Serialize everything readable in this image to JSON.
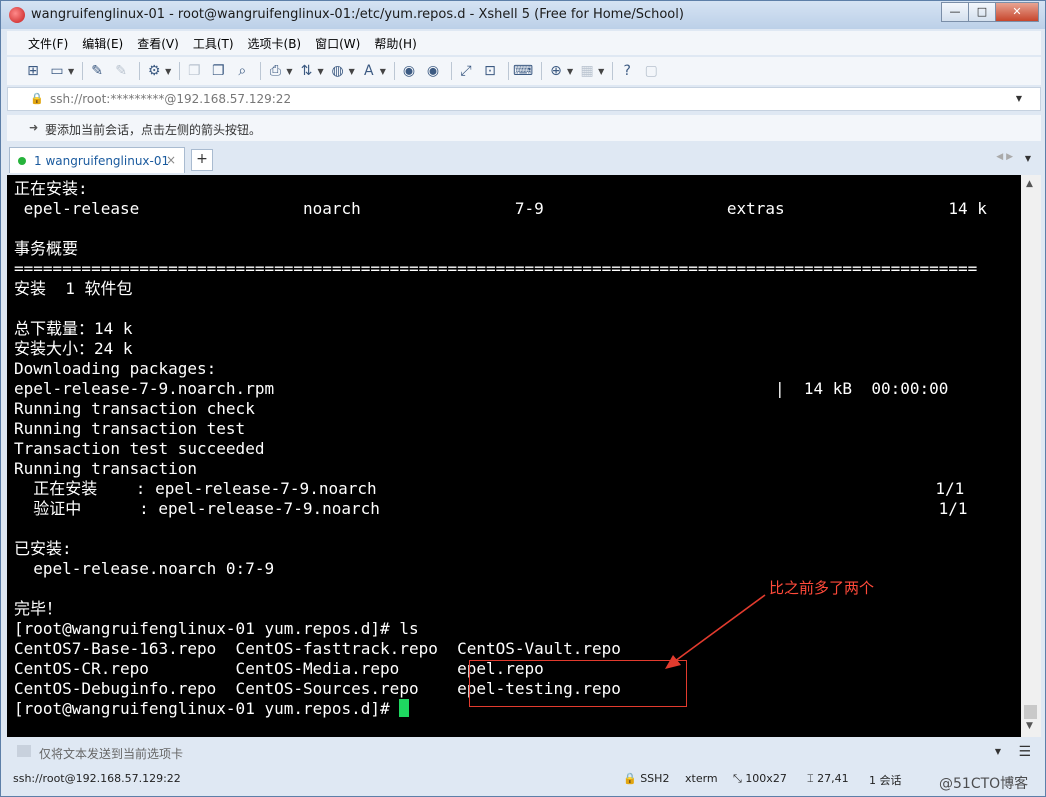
{
  "window": {
    "title": "wangruifenglinux-01 - root@wangruifenglinux-01:/etc/yum.repos.d - Xshell 5 (Free for Home/School)",
    "minimize": "—",
    "maximize": "□",
    "close": "✕"
  },
  "menu": [
    "文件(F)",
    "编辑(E)",
    "查看(V)",
    "工具(T)",
    "选项卡(B)",
    "窗口(W)",
    "帮助(H)"
  ],
  "address": {
    "value": "ssh://root:*********@192.168.57.129:22"
  },
  "hint": {
    "text": "要添加当前会话，点击左侧的箭头按钮。"
  },
  "tab": {
    "label": "1 wangruifenglinux-01",
    "close": "×",
    "add": "+",
    "nav": "◀ ▶"
  },
  "terminal": {
    "lines": [
      "正在安装:",
      " epel-release                 noarch                7-9                   extras                 14 k",
      "",
      "事务概要",
      "====================================================================================================",
      "安装  1 软件包",
      "",
      "总下载量：14 k",
      "安装大小：24 k",
      "Downloading packages:",
      "epel-release-7-9.noarch.rpm                                                    |  14 kB  00:00:00",
      "Running transaction check",
      "Running transaction test",
      "Transaction test succeeded",
      "Running transaction",
      "  正在安装    : epel-release-7-9.noarch                                                          1/1",
      "  验证中      : epel-release-7-9.noarch                                                          1/1",
      "",
      "已安装:",
      "  epel-release.noarch 0:7-9",
      "",
      "完毕！",
      "[root@wangruifenglinux-01 yum.repos.d]# ls",
      "CentOS7-Base-163.repo  CentOS-fasttrack.repo  CentOS-Vault.repo",
      "CentOS-CR.repo         CentOS-Media.repo      epel.repo",
      "CentOS-Debuginfo.repo  CentOS-Sources.repo    epel-testing.repo"
    ],
    "prompt": "[root@wangruifenglinux-01 yum.repos.d]# ",
    "annotation": "比之前多了两个"
  },
  "input_bar": {
    "placeholder": "仅将文本发送到当前选项卡"
  },
  "status": {
    "connection": "ssh://root@192.168.57.129:22",
    "protocol": "SSH2",
    "term": "xterm",
    "size": "100x27",
    "cursor_pos": "27,41",
    "sessions": "1 会话"
  },
  "watermark": "@51CTO博客",
  "colors": {
    "cursor": "#1ed760",
    "annotation": "#ff4a3a",
    "tab_active_dot": "#26b33b"
  }
}
